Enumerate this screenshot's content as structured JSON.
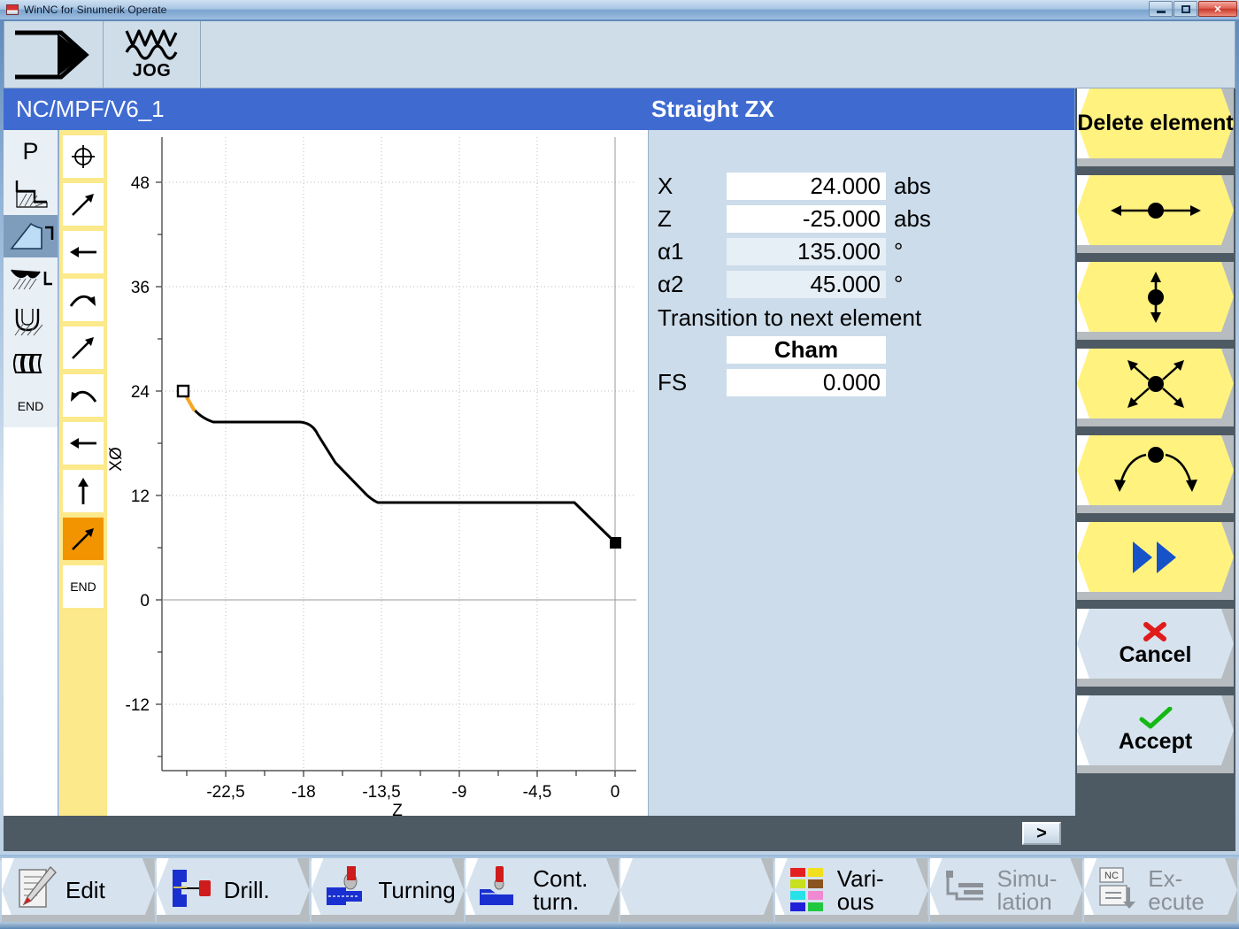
{
  "window": {
    "title": "WinNC for Sinumerik Operate",
    "controls": {
      "minimize": "minimize-icon",
      "maximize": "maximize-icon",
      "close": "✕"
    }
  },
  "modebar": {
    "channel_icon": "channel-arrow-icon",
    "mode_icon": "jog-wave-icon",
    "mode_label": "JOG"
  },
  "header": {
    "program_path": "NC/MPF/V6_1",
    "element_title": "Straight ZX"
  },
  "rail": {
    "items": [
      {
        "name": "program-start",
        "label": "P"
      },
      {
        "name": "contour-step-icon",
        "label": ""
      },
      {
        "name": "contour-straight-icon",
        "label": "",
        "selected": true
      },
      {
        "name": "contour-groove-icon",
        "label": ""
      },
      {
        "name": "contour-undercut-icon",
        "label": ""
      },
      {
        "name": "contour-thread-icon",
        "label": ""
      },
      {
        "name": "program-end",
        "label": "END"
      }
    ]
  },
  "strip": {
    "items": [
      {
        "name": "pole-start-icon",
        "label": "",
        "active": false
      },
      {
        "name": "line-diagonal-up-icon",
        "label": "",
        "active": false
      },
      {
        "name": "line-left-icon",
        "label": "",
        "active": false
      },
      {
        "name": "arc-cw-icon",
        "label": "",
        "active": false
      },
      {
        "name": "line-diagonal-up2-icon",
        "label": "",
        "active": false
      },
      {
        "name": "arc-ccw-icon",
        "label": "",
        "active": false
      },
      {
        "name": "line-left2-icon",
        "label": "",
        "active": false
      },
      {
        "name": "line-up-icon",
        "label": "",
        "active": false
      },
      {
        "name": "line-diagonal-selected-icon",
        "label": "",
        "active": true
      },
      {
        "name": "contour-end",
        "label": "END",
        "active": false
      }
    ]
  },
  "params": {
    "rows": [
      {
        "label": "X",
        "value": "24.000",
        "unit": "abs",
        "readonly": false
      },
      {
        "label": "Z",
        "value": "-25.000",
        "unit": "abs",
        "readonly": false
      },
      {
        "label": "α1",
        "value": "135.000",
        "unit": "°",
        "readonly": true
      },
      {
        "label": "α2",
        "value": "45.000",
        "unit": "°",
        "readonly": true
      }
    ],
    "transition_title": "Transition to next element",
    "transition_value": "Cham",
    "fs_label": "FS",
    "fs_value": "0.000"
  },
  "softkeys": [
    {
      "name": "delete-element",
      "label": "Delete element",
      "icon": "",
      "style": "yellow"
    },
    {
      "name": "move-horizontal",
      "label": "",
      "icon": "arrows-horizontal-icon",
      "style": "yellow"
    },
    {
      "name": "move-vertical",
      "label": "",
      "icon": "arrows-vertical-icon",
      "style": "yellow"
    },
    {
      "name": "move-diagonal",
      "label": "",
      "icon": "arrows-diagonal-icon",
      "style": "yellow"
    },
    {
      "name": "move-arc",
      "label": "",
      "icon": "arrows-arc-icon",
      "style": "yellow"
    },
    {
      "name": "next-page",
      "label": "",
      "icon": "double-chevron-right-icon",
      "style": "yellow"
    },
    {
      "name": "cancel",
      "label": "Cancel",
      "icon": "red-x-icon",
      "style": "pale"
    },
    {
      "name": "accept",
      "label": "Accept",
      "icon": "green-check-icon",
      "style": "pale"
    }
  ],
  "nav": {
    "forward_label": ">"
  },
  "taskbar": [
    {
      "name": "edit",
      "label": "Edit",
      "icon": "edit-pencil-icon",
      "disabled": false
    },
    {
      "name": "drill",
      "label": "Drill.",
      "icon": "drill-icon",
      "disabled": false
    },
    {
      "name": "turning",
      "label": "Turning",
      "icon": "turning-icon",
      "disabled": false
    },
    {
      "name": "cont-turn",
      "label": "Cont. turn.",
      "icon": "contour-turn-icon",
      "disabled": false
    },
    {
      "name": "blank",
      "label": "",
      "icon": "",
      "disabled": false
    },
    {
      "name": "various",
      "label": "Vari- ous",
      "icon": "various-colors-icon",
      "disabled": false
    },
    {
      "name": "simulation",
      "label": "Simu- lation",
      "icon": "simulation-icon",
      "disabled": true
    },
    {
      "name": "execute",
      "label": "Ex- ecute",
      "icon": "nc-execute-icon",
      "disabled": true
    }
  ],
  "chart_data": {
    "type": "line",
    "title": "",
    "xlabel": "Z",
    "ylabel": "XØ",
    "xlim": [
      -25.4,
      0.9
    ],
    "ylim": [
      -19.5,
      53.5
    ],
    "xticks": [
      -22.5,
      -18,
      -13.5,
      -9,
      -4.5,
      0
    ],
    "xticklabels": [
      "-22,5",
      "-18",
      "-13,5",
      "-9",
      "-4,5",
      "0"
    ],
    "yticks": [
      48,
      36,
      24,
      12,
      0,
      -12
    ],
    "yticklabels": [
      "48",
      "36",
      "24",
      "12",
      "0",
      "-12"
    ],
    "grid": true,
    "series": [
      {
        "name": "contour",
        "color": "#000000",
        "points": [
          {
            "z": -25.0,
            "x": 24.0
          },
          {
            "z": -24.3,
            "x": 21.4
          },
          {
            "z": -23.6,
            "x": 20.0
          },
          {
            "z": -18.6,
            "x": 20.0
          },
          {
            "z": -17.6,
            "x": 18.2
          },
          {
            "z": -14.7,
            "x": 13.6
          },
          {
            "z": -13.9,
            "x": 12.6
          },
          {
            "z": -13.3,
            "x": 12.0
          },
          {
            "z": -1.8,
            "x": 12.0
          },
          {
            "z": 0.0,
            "x": 8.4
          }
        ]
      },
      {
        "name": "selected-element",
        "color": "#f5a623",
        "points": [
          {
            "z": -25.0,
            "x": 24.0
          },
          {
            "z": -24.2,
            "x": 21.3
          }
        ]
      }
    ],
    "markers": [
      {
        "name": "start-marker",
        "z": -25.0,
        "x": 24.0,
        "style": "open-square"
      },
      {
        "name": "end-marker",
        "z": 0.0,
        "x": 8.4,
        "style": "filled-square"
      }
    ]
  }
}
